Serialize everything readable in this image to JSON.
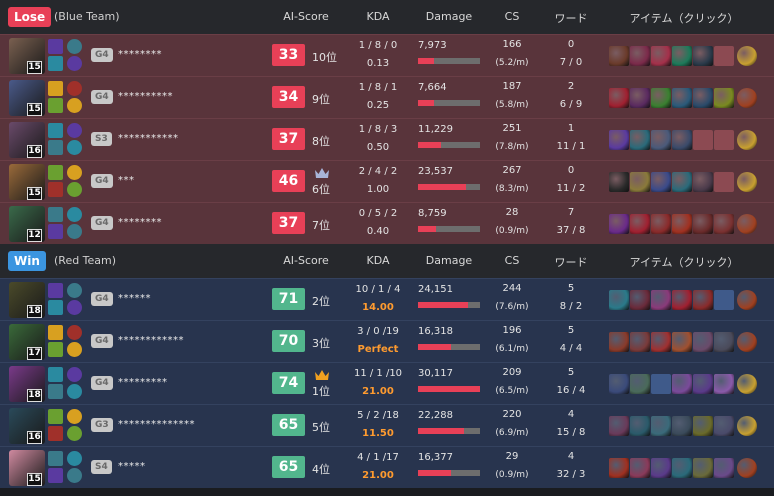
{
  "lose_team": {
    "result": "Lose",
    "name": "(Blue Team)"
  },
  "win_team": {
    "result": "Win",
    "name": "(Red Team)"
  },
  "columns": {
    "ai_score": "AI-Score",
    "kda": "KDA",
    "damage": "Damage",
    "cs": "CS",
    "ward": "ワード",
    "items": "アイテム（クリック）"
  },
  "colors": {
    "lose": "#e84057",
    "win": "#3b95e0",
    "score_win": "#52b68d",
    "orange": "#ff9b2f"
  },
  "lose_players": [
    {
      "level": "15",
      "rank": "G4",
      "name": "********",
      "score": "33",
      "place": "10位",
      "kda": "1 / 8 / 0",
      "kda_ratio": "0.13",
      "damage": "7,973",
      "damage_pct": 0.26,
      "cs": "166",
      "cs_min": "(5.2/m)",
      "ward1": "0",
      "ward2": "7 / 0",
      "items": [
        "#6a3a2a",
        "#7b2a4a",
        "#a4304a",
        "#1d7a5a",
        "#2a3a4a",
        "empty",
        "#c8a030"
      ]
    },
    {
      "level": "15",
      "rank": "G4",
      "name": "**********",
      "score": "34",
      "place": "9位",
      "kda": "1 / 8 / 1",
      "kda_ratio": "0.25",
      "damage": "7,664",
      "damage_pct": 0.25,
      "cs": "187",
      "cs_min": "(5.8/m)",
      "ward1": "2",
      "ward2": "6 / 9",
      "items": [
        "#a02030",
        "#5a2a60",
        "#3a8030",
        "#2a5a7a",
        "#2a4a6a",
        "#7a8a20",
        "#a04020"
      ]
    },
    {
      "level": "16",
      "rank": "S3",
      "name": "***********",
      "score": "37",
      "place": "8位",
      "kda": "1 / 8 / 3",
      "kda_ratio": "0.50",
      "damage": "11,229",
      "damage_pct": 0.37,
      "cs": "251",
      "cs_min": "(7.8/m)",
      "ward1": "1",
      "ward2": "11 / 1",
      "items": [
        "#5a3aa0",
        "#2a6a7a",
        "#4a5a7a",
        "#3a4a6a",
        "empty",
        "empty",
        "#c8a030"
      ]
    },
    {
      "level": "15",
      "rank": "G4",
      "name": "***",
      "score": "46",
      "place": "6位",
      "kda": "2 / 4 / 2",
      "kda_ratio": "1.00",
      "damage": "23,537",
      "damage_pct": 0.78,
      "cs": "267",
      "cs_min": "(8.3/m)",
      "ward1": "0",
      "ward2": "11 / 2",
      "items": [
        "#2a2a2a",
        "#8a7a3a",
        "#3a4a8a",
        "#2a6a7a",
        "#4a3a4a",
        "empty",
        "#c8a030"
      ]
    },
    {
      "level": "12",
      "rank": "G4",
      "name": "********",
      "score": "37",
      "place": "7位",
      "kda": "0 / 5 / 2",
      "kda_ratio": "0.40",
      "damage": "8,759",
      "damage_pct": 0.29,
      "cs": "28",
      "cs_min": "(0.9/m)",
      "ward1": "7",
      "ward2": "37 / 8",
      "items": [
        "#6a2a8a",
        "#a02030",
        "#8a2a2a",
        "#a03020",
        "#6a2a2a",
        "#7a3030",
        "#a04020"
      ]
    }
  ],
  "win_players": [
    {
      "level": "18",
      "rank": "G4",
      "name": "******",
      "score": "71",
      "place": "2位",
      "kda": "10 / 1 / 4",
      "kda_ratio": "14.00",
      "kda_orange": true,
      "damage": "24,151",
      "damage_pct": 0.8,
      "cs": "244",
      "cs_min": "(7.6/m)",
      "ward1": "5",
      "ward2": "8 / 2",
      "items": [
        "#2a7a8a",
        "#6a2a3a",
        "#8a3a7a",
        "#a02030",
        "#8a2a2a",
        "empty",
        "#a04020"
      ]
    },
    {
      "level": "17",
      "rank": "G4",
      "name": "************",
      "score": "70",
      "place": "3位",
      "kda": "3 / 0 /19",
      "kda_ratio": "Perfect",
      "kda_orange": true,
      "damage": "16,318",
      "damage_pct": 0.54,
      "cs": "196",
      "cs_min": "(6.1/m)",
      "ward1": "5",
      "ward2": "4 / 4",
      "items": [
        "#8a3a2a",
        "#7a3a3a",
        "#a03030",
        "#a05030",
        "#6a4a6a",
        "#4a4a5a",
        "#a04020"
      ]
    },
    {
      "level": "18",
      "rank": "G4",
      "name": "*********",
      "score": "74",
      "place": "1位",
      "top": true,
      "kda": "11 / 1 /10",
      "kda_ratio": "21.00",
      "kda_orange": true,
      "damage": "30,117",
      "damage_pct": 1.0,
      "cs": "209",
      "cs_min": "(6.5/m)",
      "ward1": "5",
      "ward2": "16 / 4",
      "items": [
        "#3a4a7a",
        "#4a6a5a",
        "empty",
        "#7a4a9a",
        "#5a3a8a",
        "#8a5aaa",
        "#c8a030"
      ]
    },
    {
      "level": "16",
      "rank": "G3",
      "name": "**************",
      "score": "65",
      "place": "5位",
      "kda": "5 / 2 /18",
      "kda_ratio": "11.50",
      "kda_orange": true,
      "damage": "22,288",
      "damage_pct": 0.74,
      "cs": "220",
      "cs_min": "(6.9/m)",
      "ward1": "4",
      "ward2": "15 / 8",
      "items": [
        "#6a3a5a",
        "#2a5a6a",
        "#3a6a7a",
        "#3a4a5a",
        "#6a6a2a",
        "#4a4a6a",
        "#c8a030"
      ]
    },
    {
      "level": "15",
      "rank": "S4",
      "name": "*****",
      "score": "65",
      "place": "4位",
      "kda": "4 / 1 /17",
      "kda_ratio": "21.00",
      "kda_orange": true,
      "damage": "16,377",
      "damage_pct": 0.54,
      "cs": "29",
      "cs_min": "(0.9/m)",
      "ward1": "4",
      "ward2": "32 / 3",
      "items": [
        "#a03020",
        "#8a3a5a",
        "#5a3a8a",
        "#2a6a7a",
        "#6a6a3a",
        "#6a4a8a",
        "#a04020"
      ]
    }
  ],
  "champ_colors_lose": [
    "#7a6050",
    "#4a5a8a",
    "#6a4a6a",
    "#9a6a3a",
    "#3a6a4a"
  ],
  "champ_colors_win": [
    "#4a4a2a",
    "#3a6a3a",
    "#7a3a8a",
    "#2a4a5a",
    "#d08aa0"
  ]
}
